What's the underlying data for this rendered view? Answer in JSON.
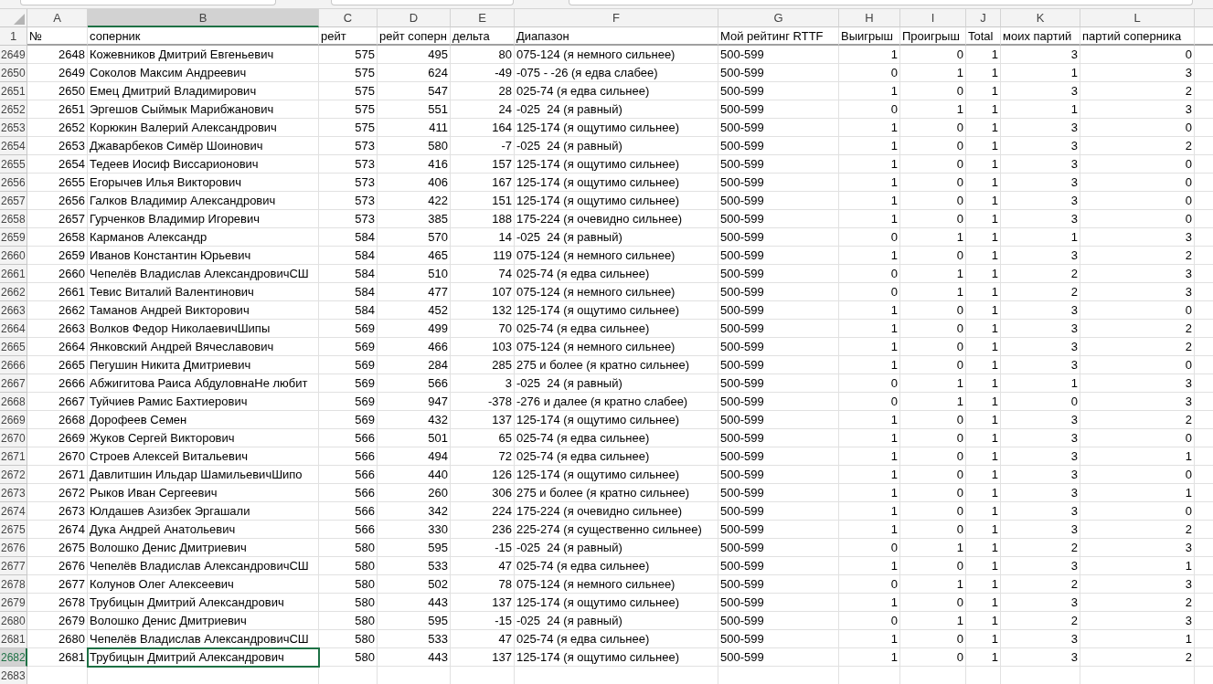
{
  "columns": [
    {
      "label": "A",
      "selected": false
    },
    {
      "label": "B",
      "selected": true
    },
    {
      "label": "C",
      "selected": false
    },
    {
      "label": "D",
      "selected": false
    },
    {
      "label": "E",
      "selected": false
    },
    {
      "label": "F",
      "selected": false
    },
    {
      "label": "G",
      "selected": false
    },
    {
      "label": "H",
      "selected": false
    },
    {
      "label": "I",
      "selected": false
    },
    {
      "label": "J",
      "selected": false
    },
    {
      "label": "K",
      "selected": false
    },
    {
      "label": "L",
      "selected": false
    }
  ],
  "header_row": {
    "number": "1",
    "cells": [
      "№",
      "соперник",
      "рейт",
      "рейт соперн",
      "дельта",
      "Диапазон",
      "Мой рейтинг RTTF",
      "Выигрыш",
      "Проигрыш",
      "Total",
      "моих партий",
      "партий соперника"
    ]
  },
  "rows": [
    {
      "number": "2649",
      "selected": false,
      "cells": [
        "2648",
        "Кожевников Дмитрий Евгеньевич",
        "575",
        "495",
        "80",
        "075-124 (я немного сильнее)",
        "500-599",
        "1",
        "0",
        "1",
        "3",
        "0"
      ]
    },
    {
      "number": "2650",
      "selected": false,
      "cells": [
        "2649",
        "Соколов Максим Андреевич",
        "575",
        "624",
        "-49",
        "-075 - -26 (я едва слабее)",
        "500-599",
        "0",
        "1",
        "1",
        "1",
        "3"
      ]
    },
    {
      "number": "2651",
      "selected": false,
      "cells": [
        "2650",
        "Емец Дмитрий Владимирович",
        "575",
        "547",
        "28",
        "025-74 (я едва сильнее)",
        "500-599",
        "1",
        "0",
        "1",
        "3",
        "2"
      ]
    },
    {
      "number": "2652",
      "selected": false,
      "cells": [
        "2651",
        "Эргешов Сыймык Марибжанович",
        "575",
        "551",
        "24",
        "-025  24 (я равный)",
        "500-599",
        "0",
        "1",
        "1",
        "1",
        "3"
      ]
    },
    {
      "number": "2653",
      "selected": false,
      "cells": [
        "2652",
        "Корюкин Валерий Александрович",
        "575",
        "411",
        "164",
        "125-174 (я ощутимо сильнее)",
        "500-599",
        "1",
        "0",
        "1",
        "3",
        "0"
      ]
    },
    {
      "number": "2654",
      "selected": false,
      "cells": [
        "2653",
        "Джаварбеков Симёр Шоинович",
        "573",
        "580",
        "-7",
        "-025  24 (я равный)",
        "500-599",
        "1",
        "0",
        "1",
        "3",
        "2"
      ]
    },
    {
      "number": "2655",
      "selected": false,
      "cells": [
        "2654",
        "Тедеев Иосиф Виссарионович",
        "573",
        "416",
        "157",
        "125-174 (я ощутимо сильнее)",
        "500-599",
        "1",
        "0",
        "1",
        "3",
        "0"
      ]
    },
    {
      "number": "2656",
      "selected": false,
      "cells": [
        "2655",
        "Егорычев Илья Викторович",
        "573",
        "406",
        "167",
        "125-174 (я ощутимо сильнее)",
        "500-599",
        "1",
        "0",
        "1",
        "3",
        "0"
      ]
    },
    {
      "number": "2657",
      "selected": false,
      "cells": [
        "2656",
        "Галков Владимир Александрович",
        "573",
        "422",
        "151",
        "125-174 (я ощутимо сильнее)",
        "500-599",
        "1",
        "0",
        "1",
        "3",
        "0"
      ]
    },
    {
      "number": "2658",
      "selected": false,
      "cells": [
        "2657",
        "Гурченков Владимир Игоревич",
        "573",
        "385",
        "188",
        "175-224 (я очевидно сильнее)",
        "500-599",
        "1",
        "0",
        "1",
        "3",
        "0"
      ]
    },
    {
      "number": "2659",
      "selected": false,
      "cells": [
        "2658",
        "Карманов Александр",
        "584",
        "570",
        "14",
        "-025  24 (я равный)",
        "500-599",
        "0",
        "1",
        "1",
        "1",
        "3"
      ]
    },
    {
      "number": "2660",
      "selected": false,
      "cells": [
        "2659",
        "Иванов Константин Юрьевич",
        "584",
        "465",
        "119",
        "075-124 (я немного сильнее)",
        "500-599",
        "1",
        "0",
        "1",
        "3",
        "2"
      ]
    },
    {
      "number": "2661",
      "selected": false,
      "cells": [
        "2660",
        "Чепелёв Владислав АлександровичСШ",
        "584",
        "510",
        "74",
        "025-74 (я едва сильнее)",
        "500-599",
        "0",
        "1",
        "1",
        "2",
        "3"
      ]
    },
    {
      "number": "2662",
      "selected": false,
      "cells": [
        "2661",
        "Тевис Виталий Валентинович",
        "584",
        "477",
        "107",
        "075-124 (я немного сильнее)",
        "500-599",
        "0",
        "1",
        "1",
        "2",
        "3"
      ]
    },
    {
      "number": "2663",
      "selected": false,
      "cells": [
        "2662",
        "Таманов Андрей Викторович",
        "584",
        "452",
        "132",
        "125-174 (я ощутимо сильнее)",
        "500-599",
        "1",
        "0",
        "1",
        "3",
        "0"
      ]
    },
    {
      "number": "2664",
      "selected": false,
      "cells": [
        "2663",
        "Волков Федор НиколаевичШипы",
        "569",
        "499",
        "70",
        "025-74 (я едва сильнее)",
        "500-599",
        "1",
        "0",
        "1",
        "3",
        "2"
      ]
    },
    {
      "number": "2665",
      "selected": false,
      "cells": [
        "2664",
        "Янковский Андрей Вячеславович",
        "569",
        "466",
        "103",
        "075-124 (я немного сильнее)",
        "500-599",
        "1",
        "0",
        "1",
        "3",
        "2"
      ]
    },
    {
      "number": "2666",
      "selected": false,
      "cells": [
        "2665",
        "Пегушин Никита Дмитриевич",
        "569",
        "284",
        "285",
        "275 и более (я кратно сильнее)",
        "500-599",
        "1",
        "0",
        "1",
        "3",
        "0"
      ]
    },
    {
      "number": "2667",
      "selected": false,
      "cells": [
        "2666",
        "Абжигитова Раиса АбдуловнаНе любит",
        "569",
        "566",
        "3",
        "-025  24 (я равный)",
        "500-599",
        "0",
        "1",
        "1",
        "1",
        "3"
      ]
    },
    {
      "number": "2668",
      "selected": false,
      "cells": [
        "2667",
        "Туйчиев Рамис Бахтиерович",
        "569",
        "947",
        "-378",
        "-276 и далее (я кратно слабее)",
        "500-599",
        "0",
        "1",
        "1",
        "0",
        "3"
      ]
    },
    {
      "number": "2669",
      "selected": false,
      "cells": [
        "2668",
        "Дорофеев Семен",
        "569",
        "432",
        "137",
        "125-174 (я ощутимо сильнее)",
        "500-599",
        "1",
        "0",
        "1",
        "3",
        "2"
      ]
    },
    {
      "number": "2670",
      "selected": false,
      "cells": [
        "2669",
        "Жуков Сергей Викторович",
        "566",
        "501",
        "65",
        "025-74 (я едва сильнее)",
        "500-599",
        "1",
        "0",
        "1",
        "3",
        "0"
      ]
    },
    {
      "number": "2671",
      "selected": false,
      "cells": [
        "2670",
        "Строев Алексей Витальевич",
        "566",
        "494",
        "72",
        "025-74 (я едва сильнее)",
        "500-599",
        "1",
        "0",
        "1",
        "3",
        "1"
      ]
    },
    {
      "number": "2672",
      "selected": false,
      "cells": [
        "2671",
        "Давлитшин Ильдар ШамильевичШипо",
        "566",
        "440",
        "126",
        "125-174 (я ощутимо сильнее)",
        "500-599",
        "1",
        "0",
        "1",
        "3",
        "0"
      ]
    },
    {
      "number": "2673",
      "selected": false,
      "cells": [
        "2672",
        "Рыков Иван Сергеевич",
        "566",
        "260",
        "306",
        "275 и более (я кратно сильнее)",
        "500-599",
        "1",
        "0",
        "1",
        "3",
        "1"
      ]
    },
    {
      "number": "2674",
      "selected": false,
      "cells": [
        "2673",
        "Юлдашев Азизбек Эргашали",
        "566",
        "342",
        "224",
        "175-224 (я очевидно сильнее)",
        "500-599",
        "1",
        "0",
        "1",
        "3",
        "0"
      ]
    },
    {
      "number": "2675",
      "selected": false,
      "cells": [
        "2674",
        "Дука Андрей Анатольевич",
        "566",
        "330",
        "236",
        "225-274 (я существенно сильнее)",
        "500-599",
        "1",
        "0",
        "1",
        "3",
        "2"
      ]
    },
    {
      "number": "2676",
      "selected": false,
      "cells": [
        "2675",
        "Волошко Денис Дмитриевич",
        "580",
        "595",
        "-15",
        "-025  24 (я равный)",
        "500-599",
        "0",
        "1",
        "1",
        "2",
        "3"
      ]
    },
    {
      "number": "2677",
      "selected": false,
      "cells": [
        "2676",
        "Чепелёв Владислав АлександровичСШ",
        "580",
        "533",
        "47",
        "025-74 (я едва сильнее)",
        "500-599",
        "1",
        "0",
        "1",
        "3",
        "1"
      ]
    },
    {
      "number": "2678",
      "selected": false,
      "cells": [
        "2677",
        "Колунов Олег Алексеевич",
        "580",
        "502",
        "78",
        "075-124 (я немного сильнее)",
        "500-599",
        "0",
        "1",
        "1",
        "2",
        "3"
      ]
    },
    {
      "number": "2679",
      "selected": false,
      "cells": [
        "2678",
        "Трубицын Дмитрий Александрович",
        "580",
        "443",
        "137",
        "125-174 (я ощутимо сильнее)",
        "500-599",
        "1",
        "0",
        "1",
        "3",
        "2"
      ]
    },
    {
      "number": "2680",
      "selected": false,
      "cells": [
        "2679",
        "Волошко Денис Дмитриевич",
        "580",
        "595",
        "-15",
        "-025  24 (я равный)",
        "500-599",
        "0",
        "1",
        "1",
        "2",
        "3"
      ]
    },
    {
      "number": "2681",
      "selected": false,
      "cells": [
        "2680",
        "Чепелёв Владислав АлександровичСШ",
        "580",
        "533",
        "47",
        "025-74 (я едва сильнее)",
        "500-599",
        "1",
        "0",
        "1",
        "3",
        "1"
      ]
    },
    {
      "number": "2682",
      "selected": true,
      "cells": [
        "2681",
        "Трубицын Дмитрий Александрович",
        "580",
        "443",
        "137",
        "125-174 (я ощутимо сильнее)",
        "500-599",
        "1",
        "0",
        "1",
        "3",
        "2"
      ]
    },
    {
      "number": "2683",
      "selected": false,
      "cells": []
    }
  ]
}
